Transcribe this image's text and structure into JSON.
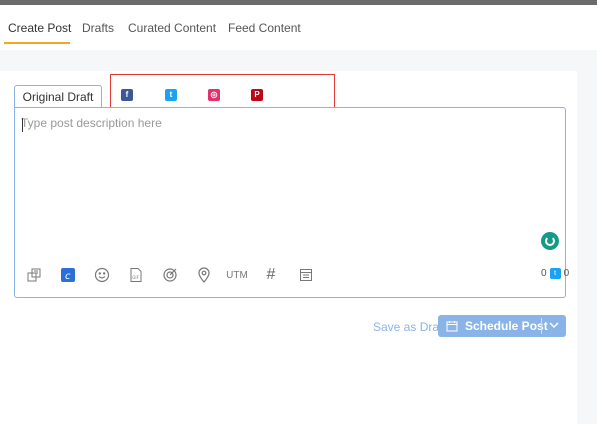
{
  "tabs": [
    {
      "label": "Create Post",
      "active": true
    },
    {
      "label": "Drafts",
      "active": false
    },
    {
      "label": "Curated Content",
      "active": false
    },
    {
      "label": "Feed Content",
      "active": false
    }
  ],
  "composer": {
    "draft_tab_label": "Original Draft",
    "networks": [
      {
        "name": "facebook-icon",
        "glyph": "f",
        "color": "#3b5998"
      },
      {
        "name": "twitter-icon",
        "glyph": "t",
        "color": "#1da1f2"
      },
      {
        "name": "instagram-icon",
        "glyph": "◎",
        "color": "#e1306c"
      },
      {
        "name": "pinterest-icon",
        "glyph": "P",
        "color": "#bd081c"
      }
    ],
    "placeholder": "Type post description here",
    "utm_label": "UTM",
    "hashtag_label": "#",
    "char_count": "0",
    "twitter_count": "0",
    "twitter_glyph": "t"
  },
  "actions": {
    "save_draft_label": "Save as Draft",
    "schedule_label": "Schedule Post"
  },
  "colors": {
    "accent": "#f5a623",
    "primary_button": "#8ab4e8",
    "highlight_border": "#e53935",
    "grammarly": "#159a86"
  }
}
